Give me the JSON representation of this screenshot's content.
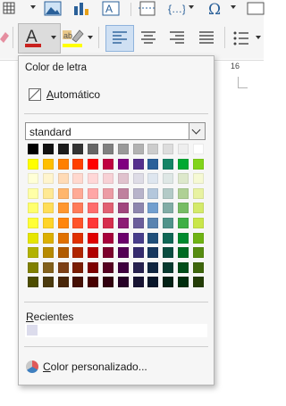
{
  "popup": {
    "title": "Color de letra",
    "automatic": {
      "underline_char": "A",
      "rest": "utomático"
    },
    "palette": {
      "selected": "standard"
    },
    "recent": {
      "underline_char": "R",
      "rest": "ecientes",
      "colors": [
        "#dcdcec"
      ]
    },
    "custom": {
      "underline_char": "C",
      "rest": "olor personalizado..."
    }
  },
  "ruler": {
    "mark": "16"
  },
  "swatches": [
    [
      "#000000",
      "#111111",
      "#1c1c1c",
      "#333333",
      "#666666",
      "#808080",
      "#999999",
      "#b2b2b2",
      "#cccccc",
      "#dddddd",
      "#eeeeee",
      "#ffffff"
    ],
    [
      "#ffff00",
      "#ffbf00",
      "#ff8000",
      "#ff4000",
      "#ff0000",
      "#bf0041",
      "#800080",
      "#55308d",
      "#2a6099",
      "#158466",
      "#00a933",
      "#81d41a"
    ],
    [
      "#ffffd7",
      "#fff5ce",
      "#ffdbb6",
      "#ffd8ce",
      "#ffd7d7",
      "#f7d1d5",
      "#e0c2cd",
      "#dedce6",
      "#dee6ef",
      "#dee7e5",
      "#dde8cb",
      "#f6f9d4"
    ],
    [
      "#ffffa6",
      "#ffe994",
      "#ffb66c",
      "#ffaa95",
      "#ffa6a6",
      "#ec9ba4",
      "#bf819e",
      "#b7b3ca",
      "#b4c7dc",
      "#b3cac7",
      "#afd095",
      "#e8f2a1"
    ],
    [
      "#ffff6d",
      "#ffde59",
      "#ff972f",
      "#ff7b59",
      "#ff6d6d",
      "#e16173",
      "#a1467e",
      "#8e86ae",
      "#729fcf",
      "#81aca6",
      "#77bc65",
      "#d4ea6b"
    ],
    [
      "#ffff38",
      "#ffd428",
      "#ff860d",
      "#ff5429",
      "#ff3838",
      "#d62e4e",
      "#8d1d75",
      "#6b5e9b",
      "#5983b0",
      "#50938a",
      "#3faf46",
      "#c9e64a"
    ],
    [
      "#e6e600",
      "#dcb000",
      "#e07000",
      "#e03000",
      "#e00000",
      "#a6003a",
      "#6b006b",
      "#483d8b",
      "#1f4e79",
      "#0e6655",
      "#008a2e",
      "#6fb313"
    ],
    [
      "#b2b200",
      "#b78a00",
      "#b05a00",
      "#b02500",
      "#b00000",
      "#7c002c",
      "#540054",
      "#352b6e",
      "#17375e",
      "#0a4d40",
      "#006b22",
      "#568c10"
    ],
    [
      "#808000",
      "#82601b",
      "#7d4016",
      "#7a1c03",
      "#7d0000",
      "#550021",
      "#3f003f",
      "#27214f",
      "#0f2540",
      "#073a2f",
      "#004d18",
      "#3e660b"
    ],
    [
      "#4d4d00",
      "#4b3a0e",
      "#492609",
      "#461005",
      "#470000",
      "#31000f",
      "#260026",
      "#181433",
      "#081629",
      "#032216",
      "#002e0e",
      "#243d07"
    ]
  ]
}
